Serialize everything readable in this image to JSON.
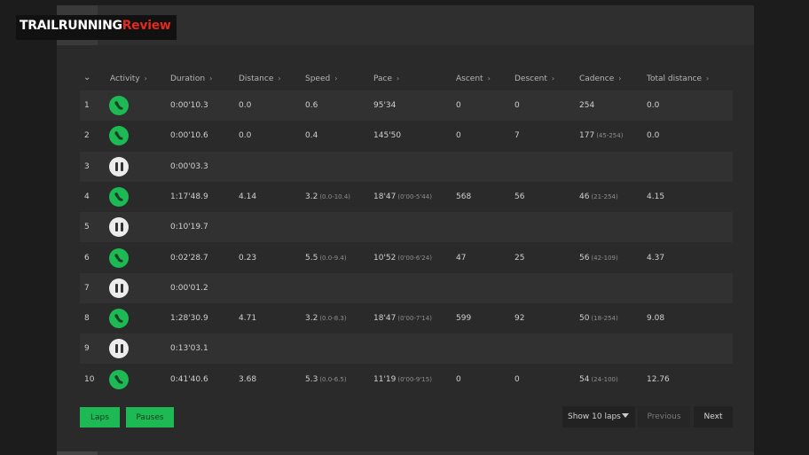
{
  "logo": {
    "part1": "TRAILRUNNING",
    "part2": "Review"
  },
  "columns": [
    {
      "key": "activity",
      "label": "Activity"
    },
    {
      "key": "duration",
      "label": "Duration"
    },
    {
      "key": "distance",
      "label": "Distance"
    },
    {
      "key": "speed",
      "label": "Speed"
    },
    {
      "key": "pace",
      "label": "Pace"
    },
    {
      "key": "ascent",
      "label": "Ascent"
    },
    {
      "key": "descent",
      "label": "Descent"
    },
    {
      "key": "cadence",
      "label": "Cadence"
    },
    {
      "key": "total_distance",
      "label": "Total distance"
    }
  ],
  "icons": {
    "sort_toggle": "chevron-down-icon",
    "run": "running-shoe-icon",
    "pause": "pause-icon"
  },
  "colors": {
    "accent_green": "#1db954",
    "logo_red": "#e02b20"
  },
  "laps": [
    {
      "n": "1",
      "type": "run",
      "duration": "0:00'10.3",
      "distance": "0.0",
      "speed": "0.6",
      "speed_range": "",
      "pace": "95'34",
      "pace_range": "",
      "ascent": "0",
      "descent": "0",
      "cadence": "254",
      "cadence_range": "",
      "total": "0.0"
    },
    {
      "n": "2",
      "type": "run",
      "duration": "0:00'10.6",
      "distance": "0.0",
      "speed": "0.4",
      "speed_range": "",
      "pace": "145'50",
      "pace_range": "",
      "ascent": "0",
      "descent": "7",
      "cadence": "177",
      "cadence_range": "(45-254)",
      "total": "0.0"
    },
    {
      "n": "3",
      "type": "pause",
      "duration": "0:00'03.3",
      "distance": "",
      "speed": "",
      "speed_range": "",
      "pace": "",
      "pace_range": "",
      "ascent": "",
      "descent": "",
      "cadence": "",
      "cadence_range": "",
      "total": ""
    },
    {
      "n": "4",
      "type": "run",
      "duration": "1:17'48.9",
      "distance": "4.14",
      "speed": "3.2",
      "speed_range": "(0.0-10.4)",
      "pace": "18'47",
      "pace_range": "(0'00-5'44)",
      "ascent": "568",
      "descent": "56",
      "cadence": "46",
      "cadence_range": "(21-254)",
      "total": "4.15"
    },
    {
      "n": "5",
      "type": "pause",
      "duration": "0:10'19.7",
      "distance": "",
      "speed": "",
      "speed_range": "",
      "pace": "",
      "pace_range": "",
      "ascent": "",
      "descent": "",
      "cadence": "",
      "cadence_range": "",
      "total": ""
    },
    {
      "n": "6",
      "type": "run",
      "duration": "0:02'28.7",
      "distance": "0.23",
      "speed": "5.5",
      "speed_range": "(0.0-9.4)",
      "pace": "10'52",
      "pace_range": "(0'00-6'24)",
      "ascent": "47",
      "descent": "25",
      "cadence": "56",
      "cadence_range": "(42-109)",
      "total": "4.37"
    },
    {
      "n": "7",
      "type": "pause",
      "duration": "0:00'01.2",
      "distance": "",
      "speed": "",
      "speed_range": "",
      "pace": "",
      "pace_range": "",
      "ascent": "",
      "descent": "",
      "cadence": "",
      "cadence_range": "",
      "total": ""
    },
    {
      "n": "8",
      "type": "run",
      "duration": "1:28'30.9",
      "distance": "4.71",
      "speed": "3.2",
      "speed_range": "(0.0-8.3)",
      "pace": "18'47",
      "pace_range": "(0'00-7'14)",
      "ascent": "599",
      "descent": "92",
      "cadence": "50",
      "cadence_range": "(18-254)",
      "total": "9.08"
    },
    {
      "n": "9",
      "type": "pause",
      "duration": "0:13'03.1",
      "distance": "",
      "speed": "",
      "speed_range": "",
      "pace": "",
      "pace_range": "",
      "ascent": "",
      "descent": "",
      "cadence": "",
      "cadence_range": "",
      "total": ""
    },
    {
      "n": "10",
      "type": "run",
      "duration": "0:41'40.6",
      "distance": "3.68",
      "speed": "5.3",
      "speed_range": "(0.0-6.5)",
      "pace": "11'19",
      "pace_range": "(0'00-9'15)",
      "ascent": "0",
      "descent": "0",
      "cadence": "54",
      "cadence_range": "(24-100)",
      "total": "12.76"
    }
  ],
  "footer": {
    "laps_label": "Laps",
    "pauses_label": "Pauses",
    "page_size_value": "Show 10 laps",
    "prev_label": "Previous",
    "next_label": "Next"
  }
}
